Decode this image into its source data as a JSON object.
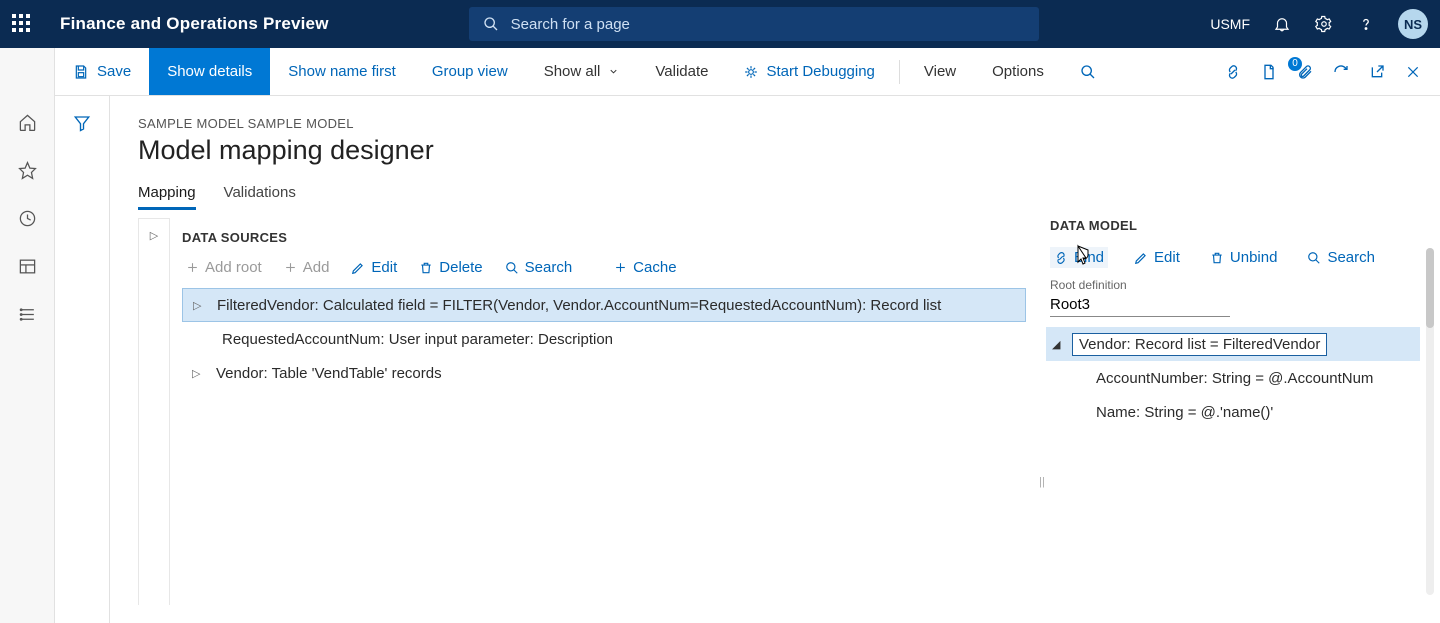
{
  "header": {
    "app_title": "Finance and Operations Preview",
    "search_placeholder": "Search for a page",
    "company": "USMF",
    "avatar_initials": "NS"
  },
  "cmd": {
    "save": "Save",
    "show_details": "Show details",
    "show_name_first": "Show name first",
    "group_view": "Group view",
    "show_all": "Show all",
    "validate": "Validate",
    "start_debugging": "Start Debugging",
    "view": "View",
    "options": "Options",
    "badge_count": "0"
  },
  "page": {
    "breadcrumb": "SAMPLE MODEL SAMPLE MODEL",
    "title": "Model mapping designer",
    "tabs": {
      "mapping": "Mapping",
      "validations": "Validations"
    }
  },
  "ds": {
    "heading": "DATA SOURCES",
    "toolbar": {
      "add_root": "Add root",
      "add": "Add",
      "edit": "Edit",
      "delete": "Delete",
      "search": "Search",
      "cache": "Cache"
    },
    "rows": [
      "FilteredVendor: Calculated field = FILTER(Vendor, Vendor.AccountNum=RequestedAccountNum): Record list",
      "RequestedAccountNum: User input parameter: Description",
      "Vendor: Table 'VendTable' records"
    ]
  },
  "dm": {
    "heading": "DATA MODEL",
    "toolbar": {
      "bind": "Bind",
      "edit": "Edit",
      "unbind": "Unbind",
      "search": "Search"
    },
    "root_label": "Root definition",
    "root_value": "Root3",
    "rows": [
      "Vendor: Record list = FilteredVendor",
      "AccountNumber: String = @.AccountNum",
      "Name: String = @.'name()'"
    ]
  }
}
